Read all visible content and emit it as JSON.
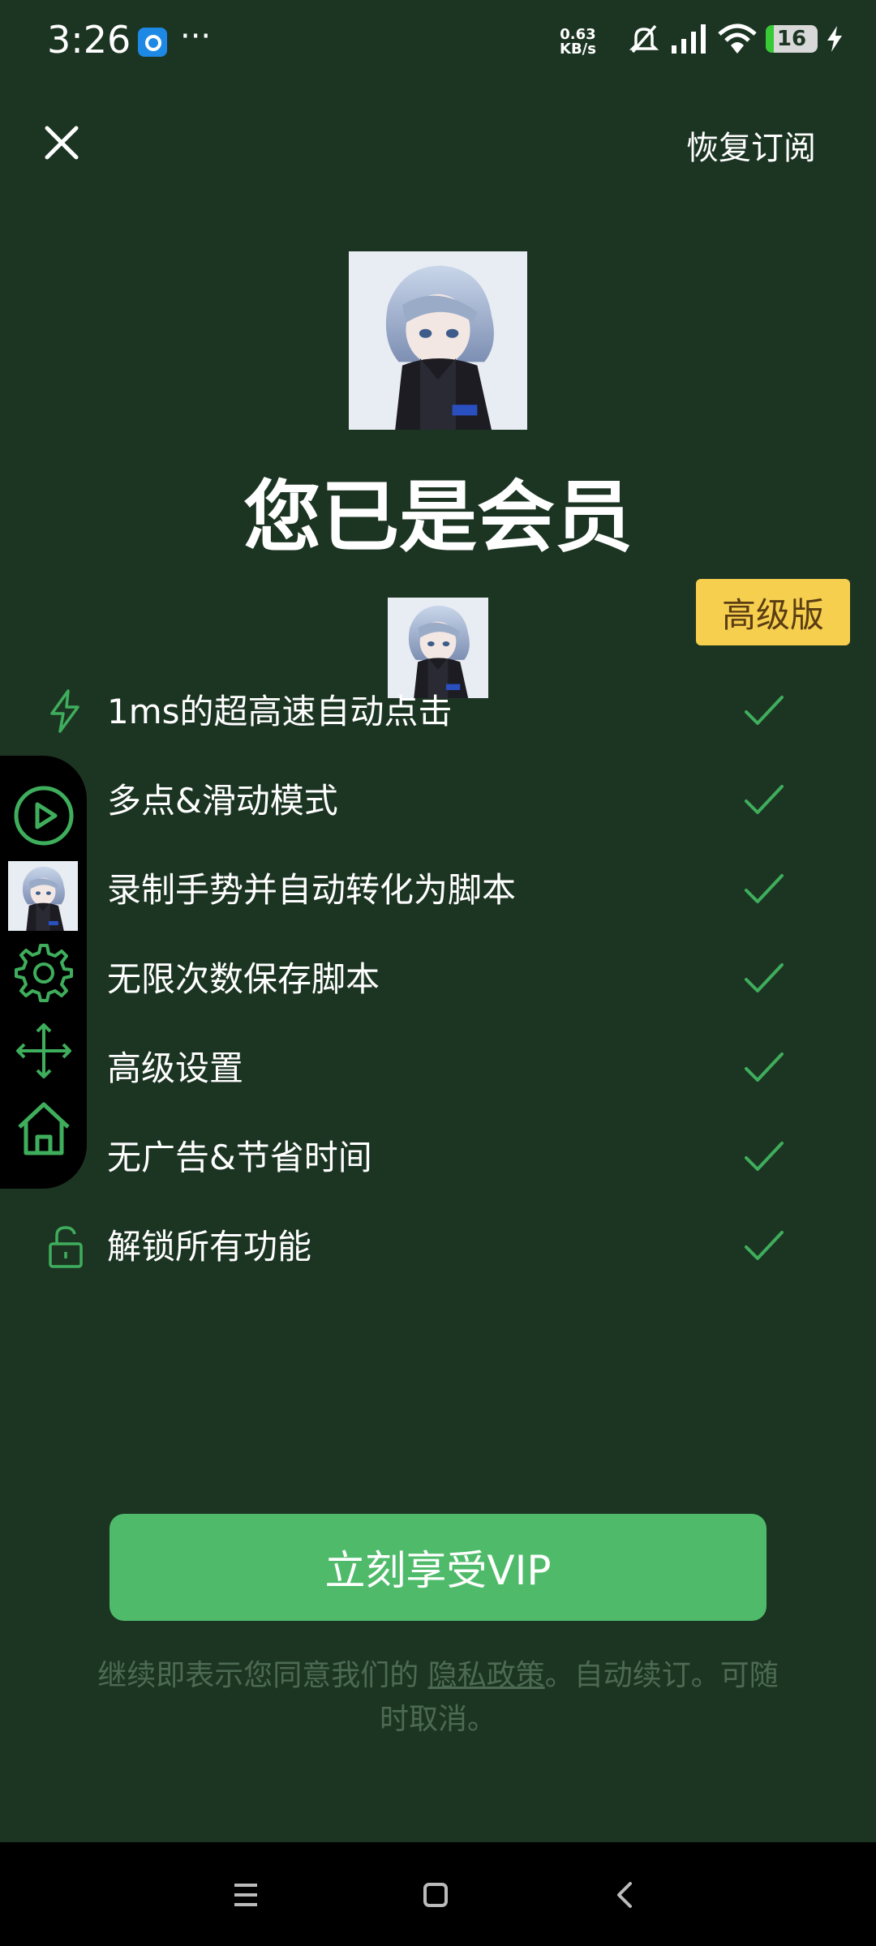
{
  "status_bar": {
    "time": "3:26",
    "more": "···",
    "net_speed_value": "0.63",
    "net_speed_unit": "KB/s",
    "battery": "16",
    "battery_level": 0.16,
    "icons": [
      "app-notification-icon",
      "mute-bell-icon",
      "signal-icon",
      "wifi-icon",
      "battery-icon",
      "charging-icon"
    ]
  },
  "header": {
    "close_icon": "close-icon",
    "restore_label": "恢复订阅"
  },
  "main": {
    "title": "您已是会员",
    "badge": "高级版"
  },
  "features": [
    {
      "icon": "lightning-icon",
      "label": "1ms的超高速自动点击"
    },
    {
      "icon": "multi-touch-icon",
      "label": "多点&滑动模式"
    },
    {
      "icon": "record-gesture-icon",
      "label": "录制手势并自动转化为脚本"
    },
    {
      "icon": "save-script-icon",
      "label": "无限次数保存脚本"
    },
    {
      "icon": "advanced-settings-icon",
      "label": "高级设置"
    },
    {
      "icon": "no-ads-icon",
      "label": "无广告&节省时间"
    },
    {
      "icon": "unlock-icon",
      "label": "解锁所有功能"
    }
  ],
  "floating_toolbar": {
    "items": [
      "play-icon",
      "avatar-thumbnail",
      "gear-icon",
      "move-icon",
      "home-icon"
    ]
  },
  "cta": {
    "label": "立刻享受VIP"
  },
  "terms": {
    "prefix": "继续即表示您同意我们的 ",
    "link": "隐私政策",
    "suffix": "。自动续订。可随时取消。"
  },
  "nav_bar": {
    "buttons": [
      "menu-icon",
      "home-square-icon",
      "back-icon"
    ]
  },
  "colors": {
    "background": "#1c3523",
    "accent_green": "#4fbb6a",
    "badge_yellow": "#f7cf4f",
    "check_green": "#3fae5c"
  }
}
